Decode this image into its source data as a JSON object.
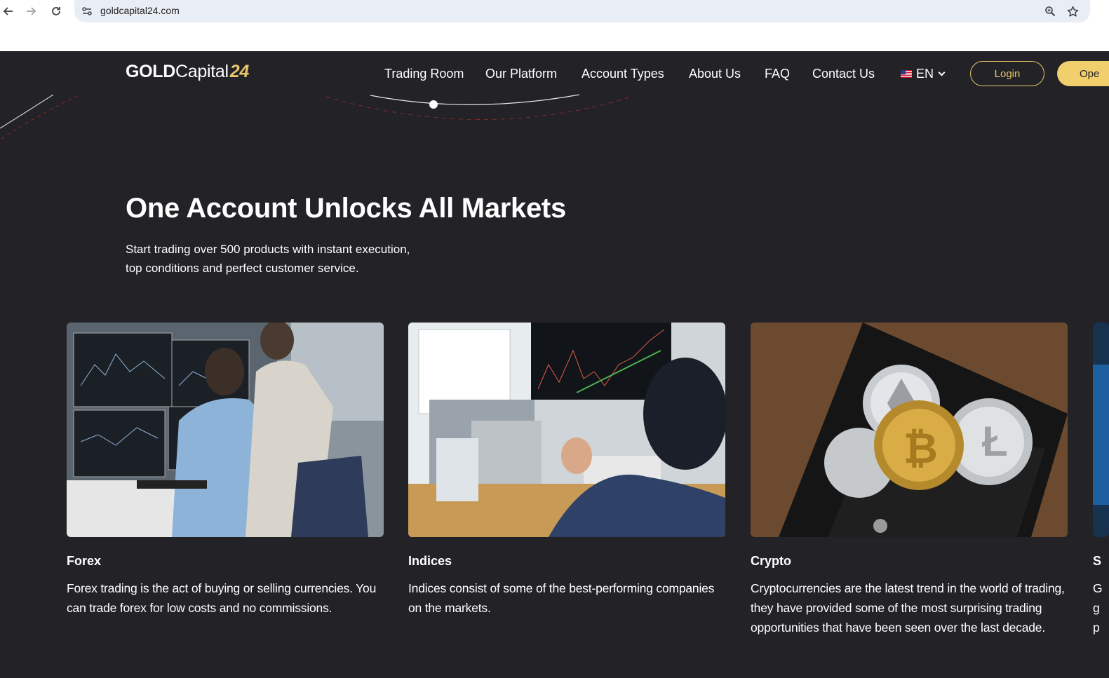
{
  "browser": {
    "url": "goldcapital24.com",
    "back_icon": "arrow-left-icon",
    "forward_icon": "arrow-right-icon",
    "reload_icon": "reload-icon",
    "zoom_icon": "zoom-icon",
    "bookmark_icon": "star-icon"
  },
  "header": {
    "logo": {
      "part1": "GOLD",
      "part2": "Capital",
      "part3": "24"
    },
    "menu": [
      {
        "label": "Trading Room"
      },
      {
        "label": "Our Platform"
      },
      {
        "label": "Account Types"
      },
      {
        "label": "About Us"
      },
      {
        "label": "FAQ"
      },
      {
        "label": "Contact Us"
      }
    ],
    "language": "EN",
    "login_label": "Login",
    "open_label": "Ope"
  },
  "hero": {
    "title": "One Account Unlocks All Markets",
    "subtitle_line1": "Start trading over 500 products with instant execution,",
    "subtitle_line2": "top conditions and perfect customer service."
  },
  "markets": [
    {
      "title": "Forex",
      "description": "Forex trading is the act of buying or selling currencies. You can trade forex for low costs and no commissions."
    },
    {
      "title": "Indices",
      "description": "Indices consist of some of the best-performing companies on the markets."
    },
    {
      "title": "Crypto",
      "description": "Cryptocurrencies are the latest trend in the world of trading, they have provided some of the most surprising trading opportunities that have been seen over the last decade."
    },
    {
      "title": "S",
      "description": "G g p"
    }
  ],
  "colors": {
    "background": "#222227",
    "accent_gold": "#e7c66a",
    "button_gold": "#f0cf6c"
  }
}
